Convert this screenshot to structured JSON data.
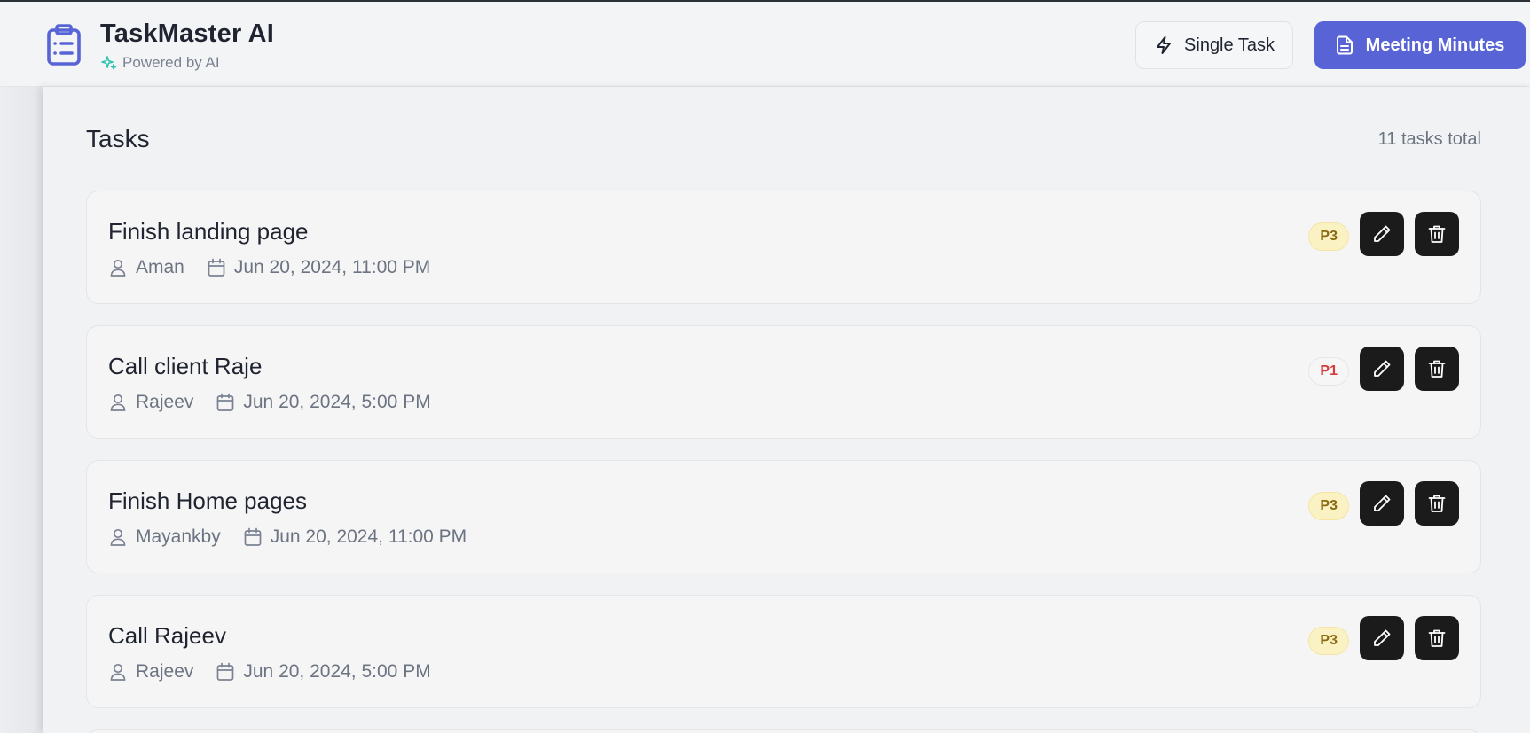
{
  "header": {
    "app_title": "TaskMaster AI",
    "subtitle": "Powered by AI",
    "single_task_label": "Single Task",
    "meeting_minutes_label": "Meeting Minutes"
  },
  "tasks_section": {
    "title": "Tasks",
    "count_label": "11 tasks total"
  },
  "tasks": [
    {
      "title": "Finish landing page",
      "assignee": "Aman",
      "due": "Jun 20, 2024, 11:00 PM",
      "priority": "P3"
    },
    {
      "title": "Call client Raje",
      "assignee": "Rajeev",
      "due": "Jun 20, 2024, 5:00 PM",
      "priority": "P1"
    },
    {
      "title": "Finish Home pages",
      "assignee": "Mayankby",
      "due": "Jun 20, 2024, 11:00 PM",
      "priority": "P3"
    },
    {
      "title": "Call Rajeev",
      "assignee": "Rajeev",
      "due": "Jun 20, 2024, 5:00 PM",
      "priority": "P3"
    }
  ],
  "colors": {
    "accent": "#5864d6",
    "action_button": "#1b1b1b",
    "p3_badge_bg": "#fbf2c4",
    "p1_text": "#d63a3a",
    "sparkle": "#2cc2b0"
  },
  "icons": {
    "logo": "clipboard-list-icon",
    "subtitle": "sparkle-icon",
    "single_task": "lightning-icon",
    "meeting_minutes": "document-icon",
    "assignee": "user-icon",
    "due": "calendar-icon",
    "edit": "pencil-icon",
    "delete": "trash-icon"
  }
}
